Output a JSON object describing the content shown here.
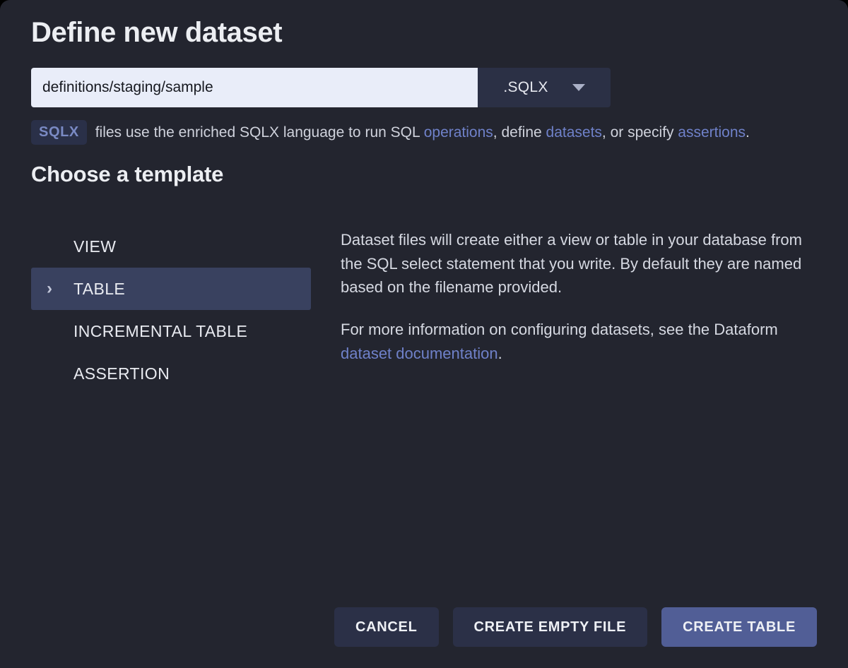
{
  "dialog": {
    "title": "Define new dataset"
  },
  "filename": {
    "value": "definitions/staging/sample",
    "placeholder": "definitions/staging/sample",
    "extension_label": ".SQLX",
    "caret_icon": "chevron-down-icon"
  },
  "helper": {
    "badge": "SQLX",
    "part1": " files use the enriched SQLX language to run SQL ",
    "link1": "operations",
    "part2": ", define ",
    "link2": "datasets",
    "part3": ", or specify ",
    "link3": "assertions",
    "part4": "."
  },
  "template_section": {
    "title": "Choose a template",
    "items": [
      {
        "label": "VIEW",
        "selected": false
      },
      {
        "label": "TABLE",
        "selected": true
      },
      {
        "label": "INCREMENTAL TABLE",
        "selected": false
      },
      {
        "label": "ASSERTION",
        "selected": false
      }
    ],
    "selected_chevron": "›",
    "description": {
      "paragraph1": "Dataset files will create either a view or table in your database from the SQL select statement that you write. By default they are named based on the filename provided.",
      "paragraph2_before": "For more information on configuring datasets, see the Dataform ",
      "paragraph2_link": "dataset documentation",
      "paragraph2_after": "."
    }
  },
  "footer": {
    "cancel_label": "CANCEL",
    "create_empty_label": "CREATE EMPTY FILE",
    "create_table_label": "CREATE TABLE"
  },
  "colors": {
    "dialog_background": "#23252f",
    "input_background": "#e9edf9",
    "select_background": "#2b3045",
    "selected_row": "#39415f",
    "link": "#6f81c9",
    "badge_background": "#2a3048",
    "badge_text": "#7a8ac4",
    "primary_button": "#515e96",
    "secondary_button": "#2b3047"
  }
}
